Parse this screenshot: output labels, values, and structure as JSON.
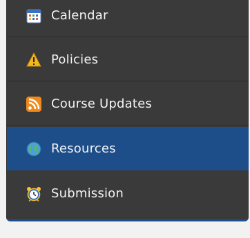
{
  "nav": {
    "items": [
      {
        "label": "Calendar",
        "icon": "calendar-icon",
        "active": false
      },
      {
        "label": "Policies",
        "icon": "warning-icon",
        "active": false
      },
      {
        "label": "Course Updates",
        "icon": "rss-icon",
        "active": false
      },
      {
        "label": "Resources",
        "icon": "globe-icon",
        "active": true
      },
      {
        "label": "Submission",
        "icon": "alarm-clock-icon",
        "active": false
      }
    ]
  },
  "colors": {
    "panel_background": "#3a3a3a",
    "active_background": "#1d4e8a",
    "page_background": "#f2f2f2",
    "label_text": "#f4f4f4"
  }
}
